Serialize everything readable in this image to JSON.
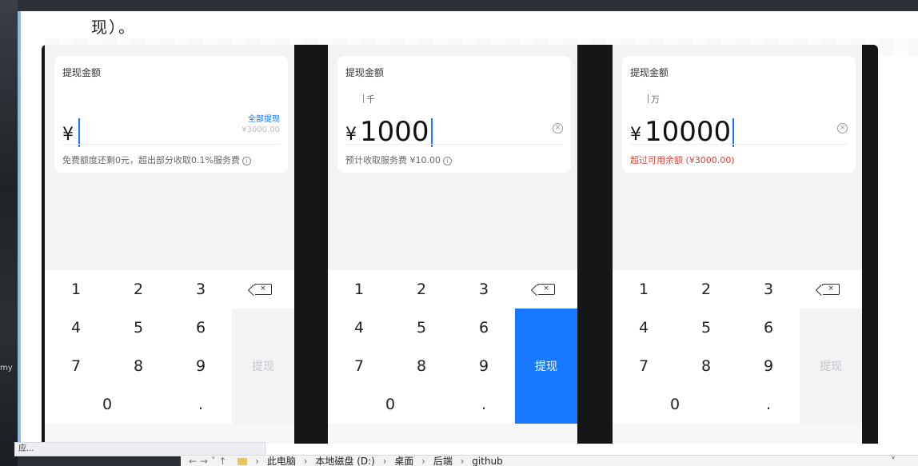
{
  "doc": {
    "lead_text": "现）。"
  },
  "panels": [
    {
      "card_title": "提现金额",
      "unit_hint": "",
      "currency": "¥",
      "amount": "",
      "all_withdraw": "全部提现",
      "balance_hint": "¥3000.00",
      "note": "免费额度还剩0元，超出部分收取0.1%服务费",
      "note_warning": false,
      "submit_label": "提现",
      "submit_active": false
    },
    {
      "card_title": "提现金额",
      "unit_hint": "千",
      "currency": "¥",
      "amount": "1000",
      "all_withdraw": "",
      "balance_hint": "",
      "note": "预计收取服务费 ¥10.00",
      "note_warning": false,
      "submit_label": "提现",
      "submit_active": true
    },
    {
      "card_title": "提现金额",
      "unit_hint": "万",
      "currency": "¥",
      "amount": "10000",
      "all_withdraw": "",
      "balance_hint": "",
      "note": "超过可用余额 (¥3000.00)",
      "note_warning": true,
      "submit_label": "提现",
      "submit_active": false
    }
  ],
  "keypad": {
    "keys": [
      "1",
      "2",
      "3",
      "4",
      "5",
      "6",
      "7",
      "8",
      "9",
      "0",
      "."
    ],
    "delete_icon": "backspace-icon",
    "clear_icon": "clear-circle-icon",
    "info_icon": "info-circle-icon"
  },
  "status_bar": {
    "text": "应..."
  },
  "explorer": {
    "nav": "← → ˅ ↑",
    "crumbs": [
      "此电脑",
      "本地磁盘 (D:)",
      "桌面",
      "后端",
      "github"
    ],
    "separator": "›",
    "dropdown": "˅"
  },
  "colors": {
    "accent": "#1677ff",
    "warning": "#e0413a",
    "panel_bg": "#f2f3f5"
  }
}
